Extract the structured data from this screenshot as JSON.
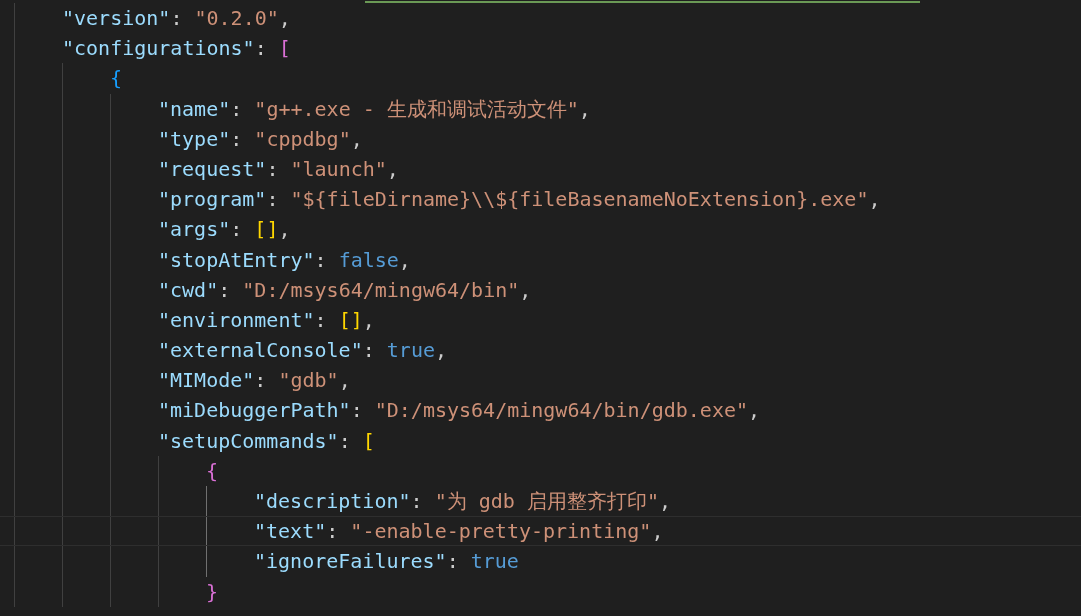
{
  "editor": {
    "lines": [
      {
        "current": false,
        "tokens": [
          {
            "kind": "key",
            "text": "\"version\""
          },
          {
            "kind": "punct",
            "text": ": "
          },
          {
            "kind": "string",
            "text": "\"0.2.0\""
          },
          {
            "kind": "punct",
            "text": ","
          }
        ]
      },
      {
        "current": false,
        "tokens": [
          {
            "kind": "key",
            "text": "\"configurations\""
          },
          {
            "kind": "punct",
            "text": ": "
          },
          {
            "kind": "bracket",
            "text": "[",
            "color": "#da70d6"
          }
        ],
        "children": [
          {
            "current": false,
            "tokens": [
              {
                "kind": "bracket",
                "text": "{",
                "color": "#179fff"
              }
            ],
            "children": [
              {
                "current": false,
                "tokens": [
                  {
                    "kind": "key",
                    "text": "\"name\""
                  },
                  {
                    "kind": "punct",
                    "text": ": "
                  },
                  {
                    "kind": "string",
                    "text": "\"g++.exe - 生成和调试活动文件\""
                  },
                  {
                    "kind": "punct",
                    "text": ","
                  }
                ]
              },
              {
                "current": false,
                "tokens": [
                  {
                    "kind": "key",
                    "text": "\"type\""
                  },
                  {
                    "kind": "punct",
                    "text": ": "
                  },
                  {
                    "kind": "string",
                    "text": "\"cppdbg\""
                  },
                  {
                    "kind": "punct",
                    "text": ","
                  }
                ]
              },
              {
                "current": false,
                "tokens": [
                  {
                    "kind": "key",
                    "text": "\"request\""
                  },
                  {
                    "kind": "punct",
                    "text": ": "
                  },
                  {
                    "kind": "string",
                    "text": "\"launch\""
                  },
                  {
                    "kind": "punct",
                    "text": ","
                  }
                ]
              },
              {
                "current": false,
                "tokens": [
                  {
                    "kind": "key",
                    "text": "\"program\""
                  },
                  {
                    "kind": "punct",
                    "text": ": "
                  },
                  {
                    "kind": "string",
                    "text": "\"${fileDirname}\\\\${fileBasenameNoExtension}.exe\""
                  },
                  {
                    "kind": "punct",
                    "text": ","
                  }
                ]
              },
              {
                "current": false,
                "tokens": [
                  {
                    "kind": "key",
                    "text": "\"args\""
                  },
                  {
                    "kind": "punct",
                    "text": ": "
                  },
                  {
                    "kind": "bracket",
                    "text": "[]",
                    "color": "#ffd700"
                  },
                  {
                    "kind": "punct",
                    "text": ","
                  }
                ]
              },
              {
                "current": false,
                "tokens": [
                  {
                    "kind": "key",
                    "text": "\"stopAtEntry\""
                  },
                  {
                    "kind": "punct",
                    "text": ": "
                  },
                  {
                    "kind": "bool",
                    "text": "false"
                  },
                  {
                    "kind": "punct",
                    "text": ","
                  }
                ]
              },
              {
                "current": false,
                "tokens": [
                  {
                    "kind": "key",
                    "text": "\"cwd\""
                  },
                  {
                    "kind": "punct",
                    "text": ": "
                  },
                  {
                    "kind": "string",
                    "text": "\"D:/msys64/mingw64/bin\""
                  },
                  {
                    "kind": "punct",
                    "text": ","
                  }
                ]
              },
              {
                "current": false,
                "tokens": [
                  {
                    "kind": "key",
                    "text": "\"environment\""
                  },
                  {
                    "kind": "punct",
                    "text": ": "
                  },
                  {
                    "kind": "bracket",
                    "text": "[]",
                    "color": "#ffd700"
                  },
                  {
                    "kind": "punct",
                    "text": ","
                  }
                ]
              },
              {
                "current": false,
                "tokens": [
                  {
                    "kind": "key",
                    "text": "\"externalConsole\""
                  },
                  {
                    "kind": "punct",
                    "text": ": "
                  },
                  {
                    "kind": "bool",
                    "text": "true"
                  },
                  {
                    "kind": "punct",
                    "text": ","
                  }
                ]
              },
              {
                "current": false,
                "tokens": [
                  {
                    "kind": "key",
                    "text": "\"MIMode\""
                  },
                  {
                    "kind": "punct",
                    "text": ": "
                  },
                  {
                    "kind": "string",
                    "text": "\"gdb\""
                  },
                  {
                    "kind": "punct",
                    "text": ","
                  }
                ]
              },
              {
                "current": false,
                "tokens": [
                  {
                    "kind": "key",
                    "text": "\"miDebuggerPath\""
                  },
                  {
                    "kind": "punct",
                    "text": ": "
                  },
                  {
                    "kind": "string",
                    "text": "\"D:/msys64/mingw64/bin/gdb.exe\""
                  },
                  {
                    "kind": "punct",
                    "text": ","
                  }
                ]
              },
              {
                "current": false,
                "tokens": [
                  {
                    "kind": "key",
                    "text": "\"setupCommands\""
                  },
                  {
                    "kind": "punct",
                    "text": ": "
                  },
                  {
                    "kind": "bracket",
                    "text": "[",
                    "color": "#ffd700"
                  }
                ],
                "children": [
                  {
                    "current": false,
                    "tokens": [
                      {
                        "kind": "bracket",
                        "text": "{",
                        "color": "#da70d6"
                      }
                    ],
                    "children": [
                      {
                        "current": false,
                        "tokens": [
                          {
                            "kind": "key",
                            "text": "\"description\""
                          },
                          {
                            "kind": "punct",
                            "text": ": "
                          },
                          {
                            "kind": "string",
                            "text": "\"为 gdb 启用整齐打印\""
                          },
                          {
                            "kind": "punct",
                            "text": ","
                          }
                        ]
                      },
                      {
                        "current": true,
                        "tokens": [
                          {
                            "kind": "key",
                            "text": "\"text\""
                          },
                          {
                            "kind": "punct",
                            "text": ": "
                          },
                          {
                            "kind": "string",
                            "text": "\"-enable-pretty-printing\""
                          },
                          {
                            "kind": "punct",
                            "text": ","
                          }
                        ]
                      },
                      {
                        "current": false,
                        "tokens": [
                          {
                            "kind": "key",
                            "text": "\"ignoreFailures\""
                          },
                          {
                            "kind": "punct",
                            "text": ": "
                          },
                          {
                            "kind": "bool",
                            "text": "true"
                          }
                        ]
                      }
                    ]
                  },
                  {
                    "current": false,
                    "tokens": [
                      {
                        "kind": "bracket",
                        "text": "}",
                        "color": "#da70d6"
                      }
                    ]
                  }
                ]
              }
            ]
          }
        ]
      }
    ]
  }
}
